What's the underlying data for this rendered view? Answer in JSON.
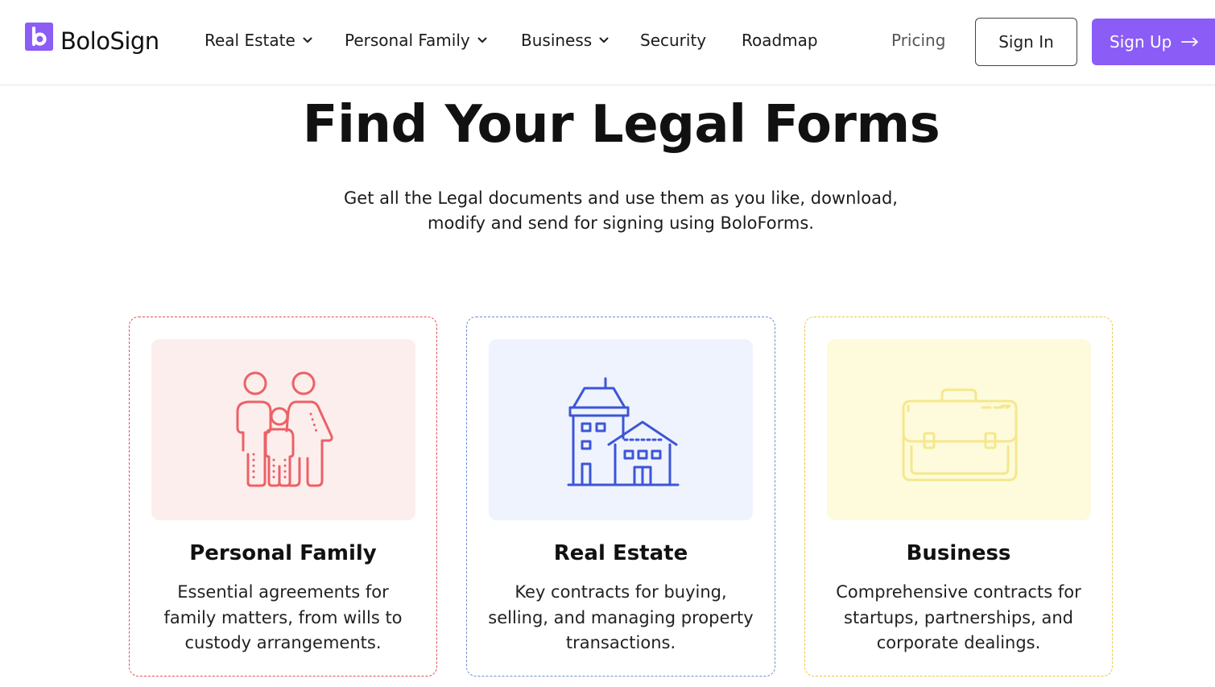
{
  "brand": {
    "name": "BoloSign",
    "accent": "#8b5cf6"
  },
  "nav": {
    "items": [
      {
        "label": "Real Estate",
        "dropdown": true
      },
      {
        "label": "Personal Family",
        "dropdown": true
      },
      {
        "label": "Business",
        "dropdown": true
      },
      {
        "label": "Security",
        "dropdown": false
      },
      {
        "label": "Roadmap",
        "dropdown": false
      }
    ],
    "pricing": "Pricing",
    "sign_in": "Sign In",
    "sign_up": "Sign Up"
  },
  "hero": {
    "title": "Find Your Legal Forms",
    "subtitle_line1": "Get all the Legal documents and use them as you like, download,",
    "subtitle_line2": "modify and send for signing using BoloForms."
  },
  "cards": [
    {
      "title": "Personal Family",
      "description": "Essential agreements for family matters, from wills to custody arrangements.",
      "icon": "family-icon",
      "border_color": "#e0505a",
      "bg_color": "#fdeeee",
      "icon_color": "#ec6166"
    },
    {
      "title": "Real Estate",
      "description": "Key contracts for buying, selling, and managing property transactions.",
      "icon": "buildings-icon",
      "border_color": "#6e8fd8",
      "bg_color": "#eef3fd",
      "icon_color": "#3d55d6"
    },
    {
      "title": "Business",
      "description": "Comprehensive contracts for startups, partnerships, and corporate dealings.",
      "icon": "briefcase-icon",
      "border_color": "#ecc746",
      "bg_color": "#fdfbdc",
      "icon_color": "#f6e78c"
    }
  ]
}
